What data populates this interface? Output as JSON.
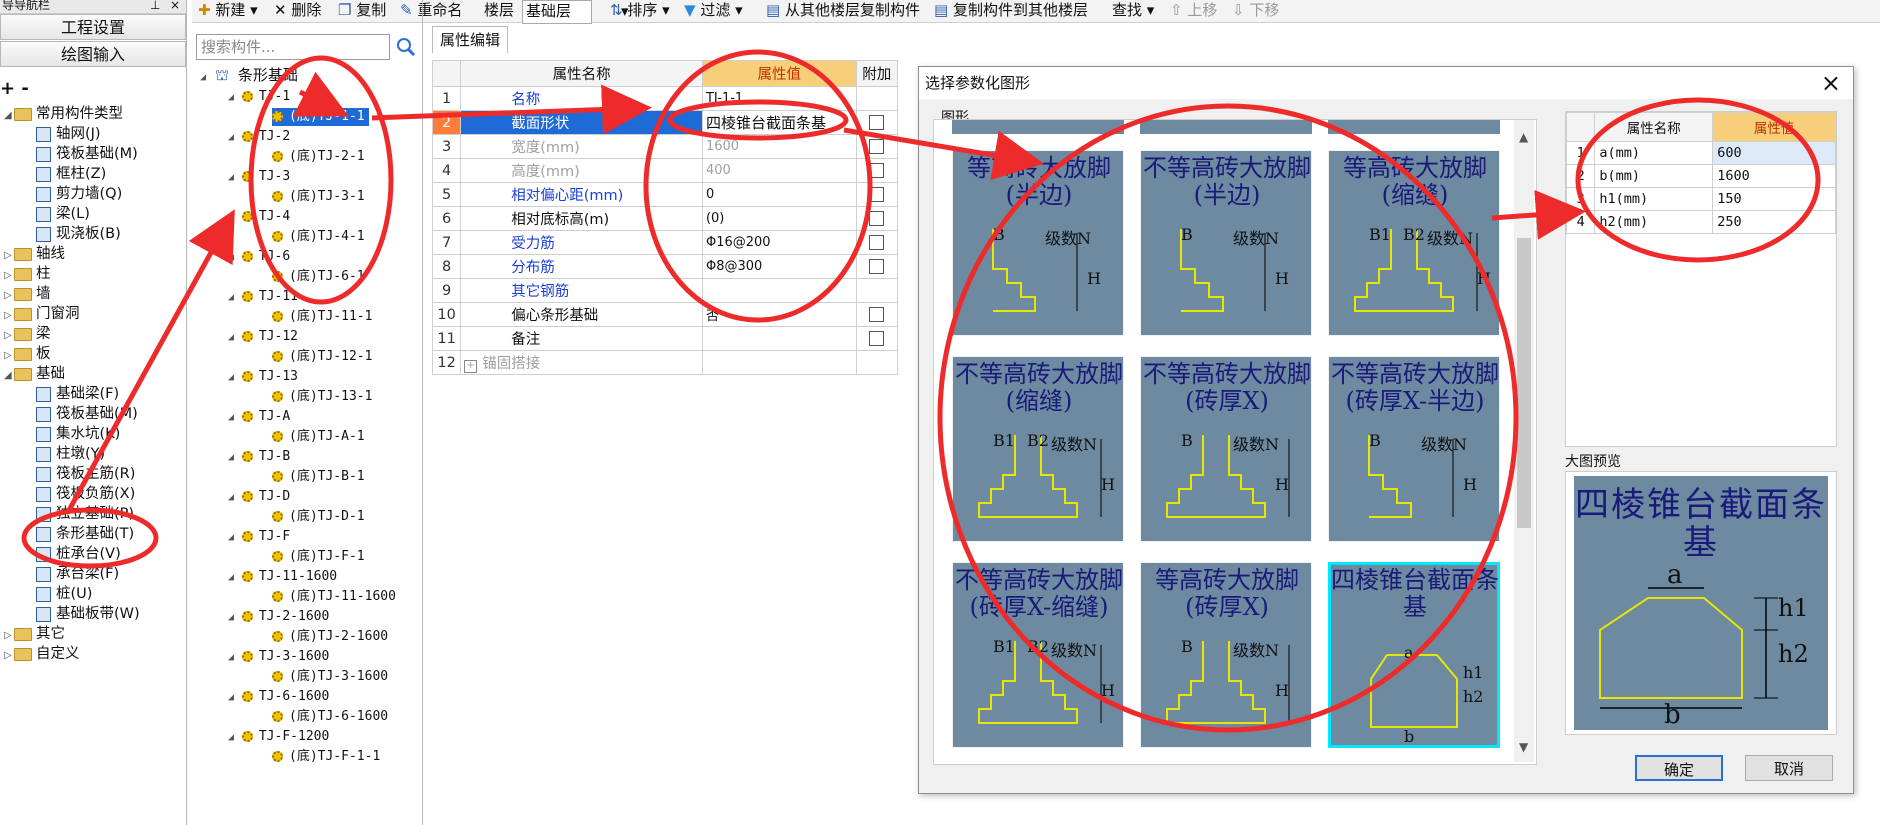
{
  "nav": {
    "title": "导导航栏",
    "buttons": [
      "工程设置",
      "绘图输入"
    ],
    "expand_icons": "+ -",
    "groups": [
      {
        "label": "常用构件类型",
        "items": [
          "轴网(J)",
          "筏板基础(M)",
          "框柱(Z)",
          "剪力墙(Q)",
          "梁(L)",
          "现浇板(B)"
        ]
      },
      {
        "label": "轴线"
      },
      {
        "label": "柱"
      },
      {
        "label": "墙"
      },
      {
        "label": "门窗洞"
      },
      {
        "label": "梁"
      },
      {
        "label": "板"
      },
      {
        "label": "基础",
        "items": [
          "基础梁(F)",
          "筏板基础(M)",
          "集水坑(K)",
          "柱墩(Y)",
          "筏板主筋(R)",
          "筏板负筋(X)",
          "独立基础(P)",
          "条形基础(T)",
          "桩承台(V)",
          "承台梁(F)",
          "桩(U)",
          "基础板带(W)"
        ]
      },
      {
        "label": "其它"
      },
      {
        "label": "自定义"
      }
    ]
  },
  "toolbar": {
    "items": [
      "新建",
      "删除",
      "复制",
      "重命名",
      "楼层",
      "基础层",
      "排序",
      "过滤",
      "从其他楼层复制构件",
      "复制构件到其他楼层",
      "查找",
      "上移",
      "下移"
    ]
  },
  "search": {
    "placeholder": "搜索构件..."
  },
  "component_tree": {
    "root": "条形基础",
    "groups": [
      {
        "name": "TJ-1",
        "child": "(底)TJ-1-1"
      },
      {
        "name": "TJ-2",
        "child": "(底)TJ-2-1"
      },
      {
        "name": "TJ-3",
        "child": "(底)TJ-3-1"
      },
      {
        "name": "TJ-4",
        "child": "(底)TJ-4-1"
      },
      {
        "name": "TJ-6",
        "child": "(底)TJ-6-1"
      },
      {
        "name": "TJ-11",
        "child": "(底)TJ-11-1"
      },
      {
        "name": "TJ-12",
        "child": "(底)TJ-12-1"
      },
      {
        "name": "TJ-13",
        "child": "(底)TJ-13-1"
      },
      {
        "name": "TJ-A",
        "child": "(底)TJ-A-1"
      },
      {
        "name": "TJ-B",
        "child": "(底)TJ-B-1"
      },
      {
        "name": "TJ-D",
        "child": "(底)TJ-D-1"
      },
      {
        "name": "TJ-F",
        "child": "(底)TJ-F-1"
      },
      {
        "name": "TJ-11-1600",
        "child": "(底)TJ-11-1600"
      },
      {
        "name": "TJ-2-1600",
        "child": "(底)TJ-2-1600"
      },
      {
        "name": "TJ-3-1600",
        "child": "(底)TJ-3-1600"
      },
      {
        "name": "TJ-6-1600",
        "child": "(底)TJ-6-1600"
      },
      {
        "name": "TJ-F-1200",
        "child": "(底)TJ-F-1-1"
      }
    ]
  },
  "property_panel": {
    "tab": "属性编辑",
    "headers": [
      "属性名称",
      "属性值",
      "附加"
    ],
    "rows": [
      {
        "num": "1",
        "name": "名称",
        "value": "TJ-1-1",
        "style": "blue",
        "check": false
      },
      {
        "num": "2",
        "name": "截面形状",
        "value": "四棱锥台截面条基",
        "style": "sel",
        "check": true
      },
      {
        "num": "3",
        "name": "宽度(mm)",
        "value": "1600",
        "style": "gray",
        "check": true
      },
      {
        "num": "4",
        "name": "高度(mm)",
        "value": "400",
        "style": "gray",
        "check": true
      },
      {
        "num": "5",
        "name": "相对偏心距(mm)",
        "value": "0",
        "style": "blue",
        "check": true
      },
      {
        "num": "6",
        "name": "相对底标高(m)",
        "value": "(0)",
        "style": "",
        "check": true
      },
      {
        "num": "7",
        "name": "受力筋",
        "value": "Φ16@200",
        "style": "blue",
        "check": true
      },
      {
        "num": "8",
        "name": "分布筋",
        "value": "Φ8@300",
        "style": "blue",
        "check": true
      },
      {
        "num": "9",
        "name": "其它钢筋",
        "value": "",
        "style": "blue",
        "check": false
      },
      {
        "num": "10",
        "name": "偏心条形基础",
        "value": "否",
        "style": "",
        "check": true
      },
      {
        "num": "11",
        "name": "备注",
        "value": "",
        "style": "",
        "check": true
      },
      {
        "num": "12",
        "name": "锚固搭接",
        "value": "",
        "style": "gray",
        "check": false
      }
    ]
  },
  "dialog": {
    "title": "选择参数化图形",
    "shapes_label": "图形",
    "tiles": [
      {
        "title": "等高砖大放脚(半边)",
        "labels": [
          "B",
          "级数N",
          "H"
        ]
      },
      {
        "title": "不等高砖大放脚(半边)",
        "labels": [
          "B",
          "级数N",
          "H"
        ]
      },
      {
        "title": "等高砖大放脚(缩缝)",
        "labels": [
          "B1",
          "B2",
          "级数N",
          "H"
        ]
      },
      {
        "title": "不等高砖大放脚(缩缝)",
        "labels": [
          "B1",
          "B2",
          "级数N",
          "H"
        ]
      },
      {
        "title": "不等高砖大放脚(砖厚X)",
        "labels": [
          "B",
          "级数N",
          "H"
        ]
      },
      {
        "title": "不等高砖大放脚(砖厚X-半边)",
        "labels": [
          "B",
          "级数N",
          "H"
        ]
      },
      {
        "title": "不等高砖大放脚(砖厚X-缩缝)",
        "labels": [
          "B1",
          "B2",
          "级数N",
          "H"
        ]
      },
      {
        "title": "等高砖大放脚(砖厚X)",
        "labels": [
          "B",
          "级数N",
          "H"
        ]
      },
      {
        "title": "四棱锥台截面条基",
        "labels": [
          "a",
          "h1",
          "h2",
          "b"
        ]
      }
    ],
    "params": {
      "headers": [
        "属性名称",
        "属性值"
      ],
      "rows": [
        {
          "num": "1",
          "name": "a(mm)",
          "value": "600"
        },
        {
          "num": "2",
          "name": "b(mm)",
          "value": "1600"
        },
        {
          "num": "3",
          "name": "h1(mm)",
          "value": "150"
        },
        {
          "num": "4",
          "name": "h2(mm)",
          "value": "250"
        }
      ]
    },
    "preview": {
      "label": "大图预览",
      "title": "四棱锥台截面条基",
      "labels": [
        "a",
        "h1",
        "h2",
        "b"
      ]
    },
    "ok": "确定",
    "cancel": "取消"
  },
  "colors": {
    "annotation": "#ee2b2b",
    "selection_blue": "#1e6ad6",
    "value_header": "#f7cf7a",
    "tile_bg": "#6d8aa1",
    "tile_selected_outline": "#00e8ff"
  }
}
